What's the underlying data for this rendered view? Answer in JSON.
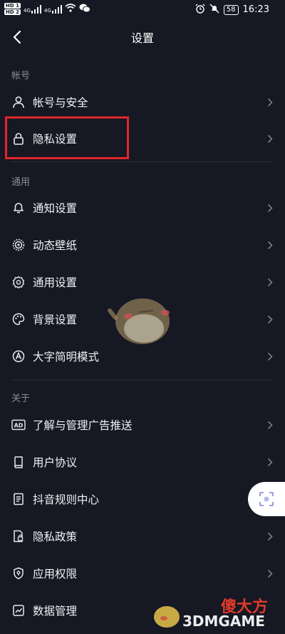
{
  "status_bar": {
    "hd1": "HD 1",
    "hd2": "HD 2",
    "signal1": "4G",
    "signal2": "4G",
    "battery": "58",
    "time": "16:23"
  },
  "header": {
    "title": "设置"
  },
  "sections": [
    {
      "title": "帐号",
      "items": [
        {
          "label": "帐号与安全",
          "icon": "user-icon"
        },
        {
          "label": "隐私设置",
          "icon": "lock-icon"
        }
      ]
    },
    {
      "title": "通用",
      "items": [
        {
          "label": "通知设置",
          "icon": "bell-icon"
        },
        {
          "label": "动态壁纸",
          "icon": "wallpaper-icon"
        },
        {
          "label": "通用设置",
          "icon": "gear-icon"
        },
        {
          "label": "背景设置",
          "icon": "palette-icon"
        },
        {
          "label": "大字简明模式",
          "icon": "font-size-icon"
        }
      ]
    },
    {
      "title": "关于",
      "items": [
        {
          "label": "了解与管理广告推送",
          "icon": "ad-icon"
        },
        {
          "label": "用户协议",
          "icon": "book-icon"
        },
        {
          "label": "抖音规则中心",
          "icon": "document-icon"
        },
        {
          "label": "隐私政策",
          "icon": "privacy-policy-icon"
        },
        {
          "label": "应用权限",
          "icon": "shield-icon"
        },
        {
          "label": "数据管理",
          "icon": "data-icon"
        }
      ]
    }
  ],
  "watermark": {
    "cn": "傻大方",
    "en": "3DMGAME"
  },
  "colors": {
    "background": "#161823",
    "highlight": "#e0262b",
    "text": "#f1f1f4",
    "section": "#8a8b93"
  }
}
